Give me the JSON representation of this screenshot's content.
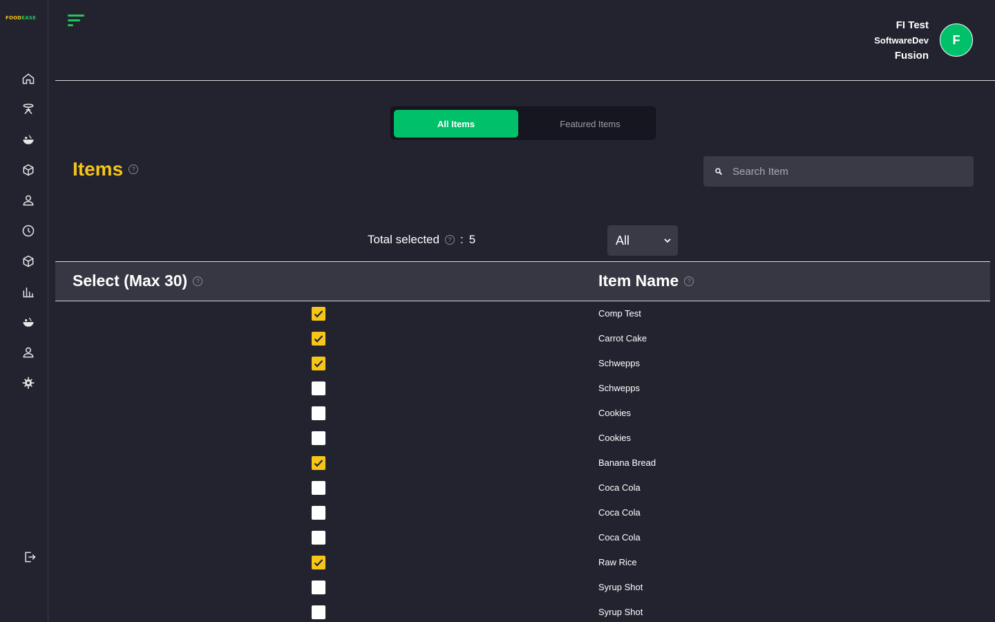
{
  "brand": {
    "part1": "FOOD",
    "part2": "EASE"
  },
  "sidebar": {
    "icons": [
      "home-icon",
      "table-icon",
      "food-icon",
      "box-icon",
      "user-icon",
      "clock-icon",
      "package-icon",
      "chart-icon",
      "food-alt-icon",
      "user-alt-icon",
      "gear-icon"
    ],
    "logout_icon": "logout-icon"
  },
  "user": {
    "name": "FI Test",
    "company": "SoftwareDev",
    "role": "Fusion",
    "avatar_letter": "F"
  },
  "tabs": {
    "all": "All Items",
    "featured": "Featured Items"
  },
  "page": {
    "title": "Items"
  },
  "search": {
    "placeholder": "Search Item"
  },
  "selection": {
    "label": "Total selected",
    "separator": ":",
    "count": "5"
  },
  "filter": {
    "selected": "All"
  },
  "table": {
    "columns": {
      "select": "Select (Max 30)",
      "name": "Item Name"
    },
    "rows": [
      {
        "name": "Comp Test",
        "checked": true
      },
      {
        "name": "Carrot Cake",
        "checked": true
      },
      {
        "name": "Schwepps",
        "checked": true
      },
      {
        "name": "Schwepps",
        "checked": false
      },
      {
        "name": "Cookies",
        "checked": false
      },
      {
        "name": "Cookies",
        "checked": false
      },
      {
        "name": "Banana Bread",
        "checked": true
      },
      {
        "name": "Coca Cola",
        "checked": false
      },
      {
        "name": "Coca Cola",
        "checked": false
      },
      {
        "name": "Coca Cola",
        "checked": false
      },
      {
        "name": "Raw Rice",
        "checked": true
      },
      {
        "name": "Syrup Shot",
        "checked": false
      },
      {
        "name": "Syrup Shot",
        "checked": false
      }
    ]
  },
  "colors": {
    "accent_green": "#00c16a",
    "accent_yellow": "#f5c518",
    "background": "#232330"
  }
}
